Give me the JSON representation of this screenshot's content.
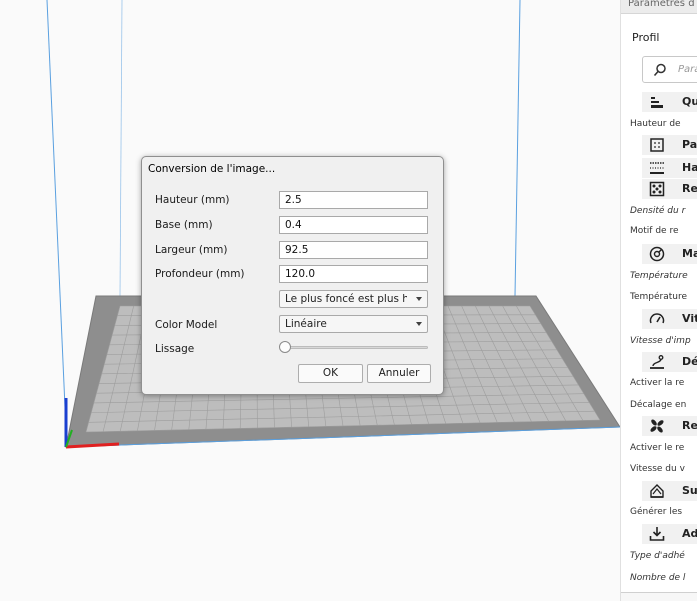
{
  "dialog": {
    "title": "Conversion de l'image...",
    "fields": [
      {
        "label": "Hauteur (mm)",
        "value": "2.5"
      },
      {
        "label": "Base (mm)",
        "value": "0.4"
      },
      {
        "label": "Largeur (mm)",
        "value": "92.5"
      },
      {
        "label": "Profondeur (mm)",
        "value": "120.0"
      }
    ],
    "brightness_combo": "Le plus foncé est plus h...",
    "color_model_label": "Color Model",
    "color_model_value": "Linéaire",
    "smoothing_label": "Lissage",
    "smoothing_level": 0,
    "ok_label": "OK",
    "cancel_label": "Annuler"
  },
  "panel": {
    "header": "Paramètres d",
    "profile_label": "Profil",
    "search_placeholder": "Para",
    "categories": [
      {
        "icon": "quality-icon",
        "label": "Qua"
      },
      {
        "icon": "walls-icon",
        "label": "Par"
      },
      {
        "icon": "top-bottom-icon",
        "label": "Ha"
      },
      {
        "icon": "infill-icon",
        "label": "Rer"
      },
      {
        "icon": "material-icon",
        "label": "Ma"
      },
      {
        "icon": "speed-icon",
        "label": "Vite"
      },
      {
        "icon": "travel-icon",
        "label": "Dé"
      },
      {
        "icon": "cooling-icon",
        "label": "Ref"
      },
      {
        "icon": "support-icon",
        "label": "Sup"
      },
      {
        "icon": "adhesion-icon",
        "label": "Adh"
      }
    ],
    "settings": [
      "Hauteur de",
      "Densité du r",
      "Motif de re",
      "Température",
      "Température",
      "Vitesse d'imp",
      "Activer la re",
      "Décalage en",
      "Activer le re",
      "Vitesse du v",
      "Générer les",
      "Type d'adhé",
      "Nombre de l"
    ]
  },
  "colors": {
    "axis_x": "#e02020",
    "axis_y": "#20b020",
    "axis_z": "#1a3fd0",
    "build_volume_line": "#5aa0e0",
    "bed": "#8e8e8e"
  }
}
